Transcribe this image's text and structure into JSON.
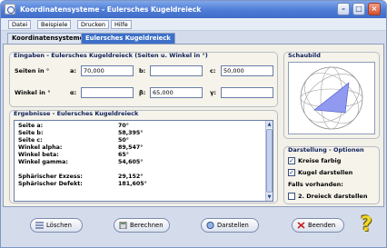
{
  "window": {
    "title": "Koordinatensysteme - Eulersches Kugeldreieck"
  },
  "menu": {
    "items": [
      "Datei",
      "Beispiele",
      "Drucken",
      "Hilfe"
    ]
  },
  "tabs": [
    "Koordinatensysteme",
    "Eulersches Kugeldreieck"
  ],
  "inputs": {
    "title": "Eingaben - Eulersches Kugeldreieck (Seiten u. Winkel in °)",
    "sides_label": "Seiten in °",
    "angles_label": "Winkel in °",
    "a_label": "a:",
    "a_value": "70,000",
    "b_label": "b:",
    "b_value": "",
    "c_label": "c:",
    "c_value": "50,000",
    "alpha_label": "α:",
    "alpha_value": "",
    "beta_label": "β:",
    "beta_value": "65,000",
    "gamma_label": "γ:",
    "gamma_value": ""
  },
  "results": {
    "title": "Ergebnisse - Eulersches Kugeldreieck",
    "rows": [
      {
        "key": "Seite a:",
        "value": "70°"
      },
      {
        "key": "Seite b:",
        "value": "58,395°"
      },
      {
        "key": "Seite c:",
        "value": "50°"
      },
      {
        "key": "Winkel alpha:",
        "value": "89,547°"
      },
      {
        "key": "Winkel beta:",
        "value": "65°"
      },
      {
        "key": "Winkel gamma:",
        "value": "54,605°"
      },
      {
        "key": "Sphärischer Exzess:",
        "value": "29,152°"
      },
      {
        "key": "Sphärischer Defekt:",
        "value": "181,605°"
      }
    ]
  },
  "schaubild": {
    "title": "Schaubild"
  },
  "display_options": {
    "title": "Darstellung - Optionen",
    "kreise_label": "Kreise farbig",
    "kreise_checked": true,
    "kugel_label": "Kugel darstellen",
    "kugel_checked": true,
    "falls_label": "Falls vorhanden:",
    "zweites_label": "2. Dreieck darstellen",
    "zweites_checked": false
  },
  "buttons": {
    "loeschen": "Löschen",
    "berechnen": "Berechnen",
    "darstellen": "Darstellen",
    "beenden": "Beenden"
  },
  "colors": {
    "accent": "#3d70c8",
    "triangle": "#8f9af0"
  }
}
